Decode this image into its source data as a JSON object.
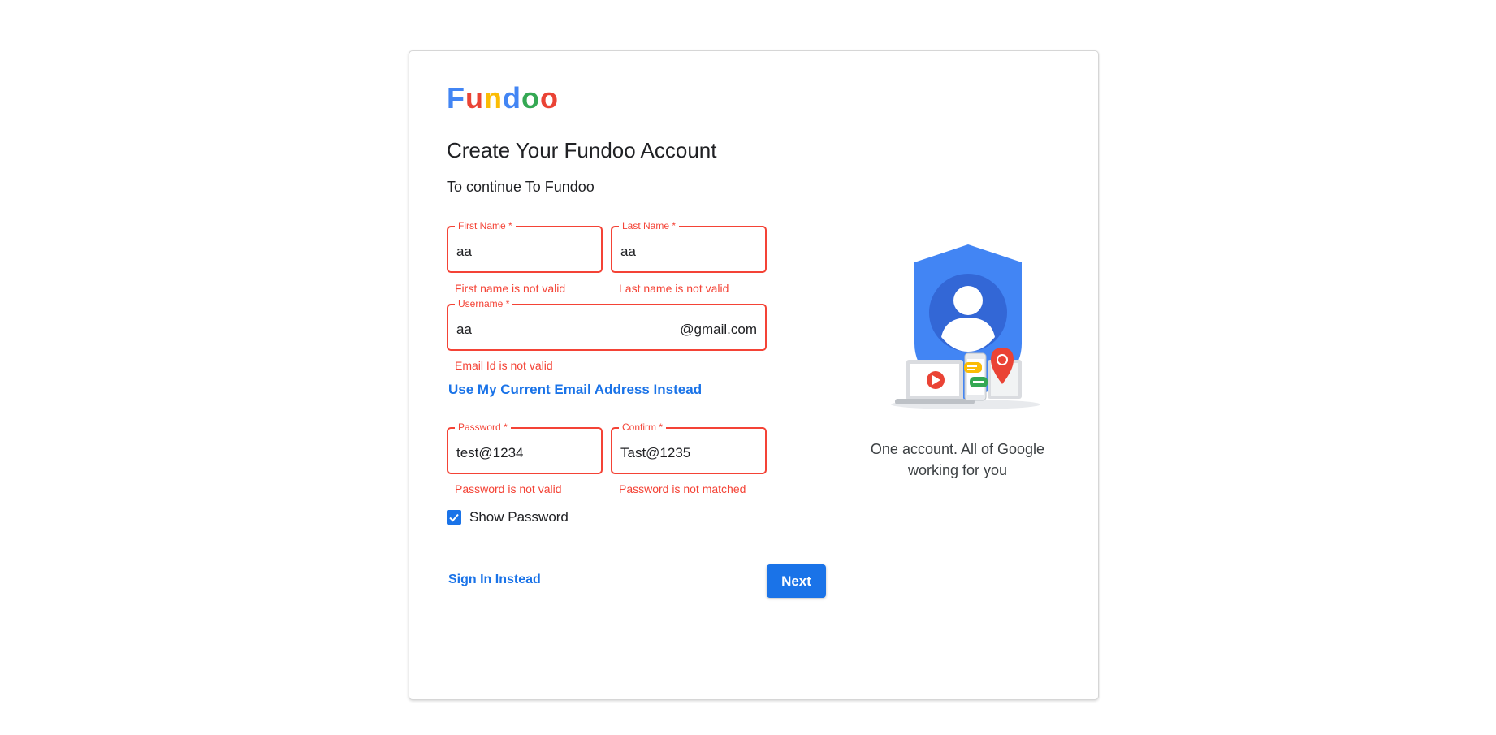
{
  "brand": {
    "letters": [
      {
        "char": "F",
        "color": "#4285f4"
      },
      {
        "char": "u",
        "color": "#ea4335"
      },
      {
        "char": "n",
        "color": "#fbbc05"
      },
      {
        "char": "d",
        "color": "#4285f4"
      },
      {
        "char": "o",
        "color": "#34a853"
      },
      {
        "char": "o",
        "color": "#ea4335"
      }
    ]
  },
  "header": {
    "title": "Create Your Fundoo Account",
    "subtitle": "To continue To Fundoo"
  },
  "form": {
    "first_name": {
      "label": "First Name *",
      "value": "aa",
      "error": "First name is not valid"
    },
    "last_name": {
      "label": "Last Name *",
      "value": "aa",
      "error": "Last name is not valid"
    },
    "username": {
      "label": "Username *",
      "value": "aa",
      "suffix": "@gmail.com",
      "error": "Email Id is not valid"
    },
    "use_email_link": "Use My Current Email Address Instead",
    "password": {
      "label": "Password *",
      "value": "test@1234",
      "error": "Password is not valid"
    },
    "confirm": {
      "label": "Confirm *",
      "value": "Tast@1235",
      "error": "Password is not matched"
    },
    "show_password": {
      "label": "Show Password",
      "checked": true
    }
  },
  "footer": {
    "sign_in_link": "Sign In Instead",
    "next_button": "Next"
  },
  "side_panel": {
    "tagline": "One account. All of Google working for you"
  },
  "colors": {
    "accent": "#1a73e8",
    "error": "#f44336"
  }
}
